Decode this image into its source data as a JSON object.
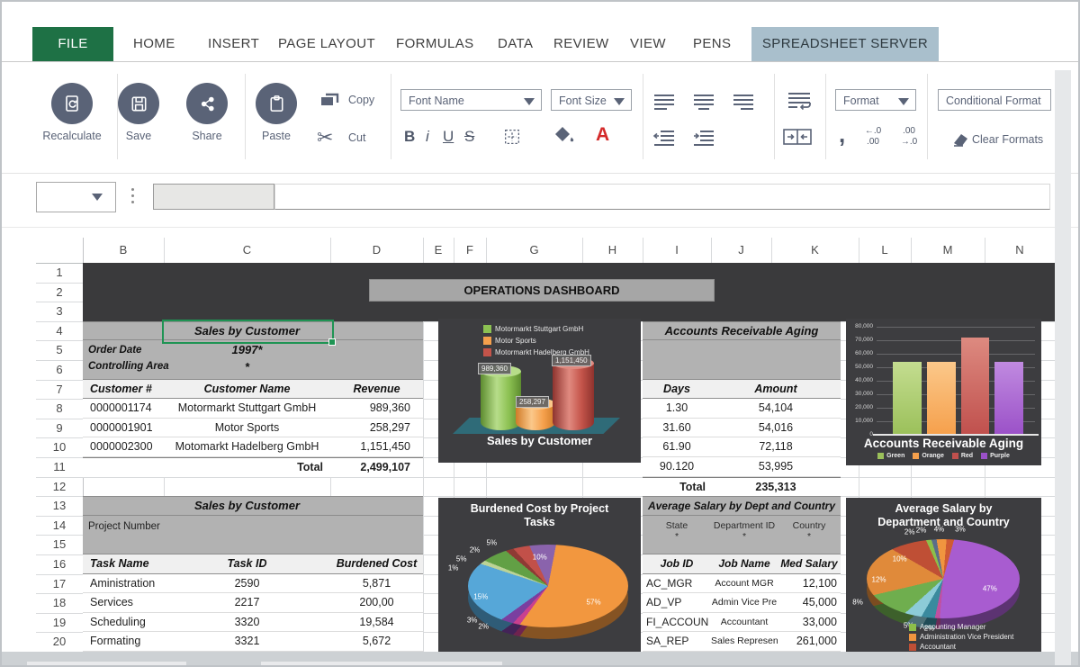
{
  "tabs": {
    "items": [
      "FILE",
      "HOME",
      "INSERT",
      "PAGE LAYOUT",
      "FORMULAS",
      "DATA",
      "REVIEW",
      "VIEW",
      "PENS",
      "SPREADSHEET SERVER"
    ],
    "active": "FILE",
    "accent_green": "#1e7145",
    "highlight_bg": "#a9bfcc"
  },
  "toolbar": {
    "recalculate_label": "Recalculate",
    "save_label": "Save",
    "share_label": "Share",
    "paste_label": "Paste",
    "copy_label": "Copy",
    "cut_label": "Cut",
    "font_name_placeholder": "Font Name",
    "font_size_placeholder": "Font Size",
    "bold": "B",
    "italic": "i",
    "underline": "U",
    "strike": "S",
    "font_color": "A",
    "format_label": "Format",
    "conditional_format_label": "Conditional Format",
    "clear_formats_label": "Clear Formats",
    "comma": ",",
    "dec_inc_top": "←.0",
    "dec_inc_bottom": ".00",
    "dec_dec_top": ".00",
    "dec_dec_bottom": "→.0",
    "icon_color": "#5a6377",
    "font_color_red": "#d42a2a"
  },
  "grid": {
    "columns": [
      "B",
      "C",
      "D",
      "E",
      "F",
      "G",
      "H",
      "I",
      "J",
      "K",
      "L",
      "M",
      "N"
    ],
    "rows": [
      "1",
      "2",
      "3",
      "4",
      "5",
      "6",
      "7",
      "8",
      "9",
      "10",
      "11",
      "12",
      "13",
      "14",
      "15",
      "16",
      "17",
      "18",
      "19",
      "20"
    ]
  },
  "dashboard": {
    "banner_title": "OPERATIONS DASHBOARD",
    "sales": {
      "title": "Sales by Customer",
      "filters": [
        {
          "label": "Order Date",
          "value": "1997*"
        },
        {
          "label": "Controlling Area",
          "value": "*"
        }
      ],
      "columns": [
        "Customer  #",
        "Customer Name",
        "Revenue"
      ],
      "rows": [
        [
          "0000001174",
          "Motormarkt Stuttgart GmbH",
          "989,360"
        ],
        [
          "0000001901",
          "Motor Sports",
          "258,297"
        ],
        [
          "0000002300",
          "Motomarkt Hadelberg GmbH",
          "1,151,450"
        ]
      ],
      "total_label": "Total",
      "total_value": "2,499,107"
    },
    "ar": {
      "title": "Accounts Receivable Aging",
      "columns": [
        "Days",
        "Amount"
      ],
      "rows": [
        [
          "1.30",
          "54,104"
        ],
        [
          "31.60",
          "54,016"
        ],
        [
          "61.90",
          "72,118"
        ],
        [
          "90.120",
          "53,995"
        ]
      ],
      "total_label": "Total",
      "total_value": "235,313"
    },
    "tasks": {
      "title": "Sales by Customer",
      "filter_label": "Project Number",
      "columns": [
        "Task Name",
        "Task ID",
        "Burdened Cost"
      ],
      "rows": [
        [
          "Aministration",
          "2590",
          "5,871"
        ],
        [
          "Services",
          "2217",
          "200,00"
        ],
        [
          "Scheduling",
          "3320",
          "19,584"
        ],
        [
          "Formating",
          "3321",
          "5,672"
        ]
      ]
    },
    "salary": {
      "title": "Average Salary by Dept and Country",
      "filters": [
        {
          "label": "State",
          "value": "*"
        },
        {
          "label": "Department ID",
          "value": "*"
        },
        {
          "label": "Country",
          "value": "*"
        }
      ],
      "columns": [
        "Job ID",
        "Job Name",
        "Med Salary"
      ],
      "rows": [
        [
          "AC_MGR",
          "Account MGR",
          "12,100"
        ],
        [
          "AD_VP",
          "Admin Vice Pre",
          "45,000"
        ],
        [
          "FI_ACCOUN",
          "Accountant",
          "33,000"
        ],
        [
          "SA_REP",
          "Sales Represen",
          "261,000"
        ]
      ]
    }
  },
  "chart_data": [
    {
      "type": "bar",
      "style": "3d-cylinder",
      "title": "Sales by Customer",
      "categories": [
        "Motormarkt Stuttgart GmbH",
        "Motor Sports",
        "Motormarkt Hadelberg GmbH"
      ],
      "values": [
        989360,
        258297,
        1151450
      ],
      "data_labels": [
        "989,360",
        "258,297",
        "1,151,450"
      ],
      "colors": [
        "#8cc152",
        "#f5a04c",
        "#c4544a"
      ],
      "colors_light": [
        "#b7dd8a",
        "#fbc88a",
        "#e08a80"
      ],
      "colors_dark": [
        "#5d8c2f",
        "#d07b28",
        "#8e332e"
      ],
      "legend_position": "top-left",
      "background": "#3d3d40",
      "floor_color": "#2f6b78"
    },
    {
      "type": "bar",
      "title": "Accounts Receivable Aging",
      "categories": [
        "Green",
        "Orange",
        "Red",
        "Purple"
      ],
      "values": [
        54104,
        54016,
        72118,
        53995
      ],
      "colors": [
        "#9bc05a",
        "#f5a04c",
        "#c0504d",
        "#9b51c8"
      ],
      "colors_light": [
        "#c4dd90",
        "#fbc88a",
        "#dd8a80",
        "#c08ae0"
      ],
      "ylim": [
        0,
        80000
      ],
      "yticks": [
        "80,000",
        "70,000",
        "60,000",
        "50,000",
        "40,000",
        "30,000",
        "20,000",
        "10,000",
        "0"
      ],
      "grid": true,
      "legend_position": "bottom",
      "background": "#3d3d40"
    },
    {
      "type": "pie",
      "title": "Burdened Cost by Project Tasks",
      "title_lines": [
        "Burdened Cost by Project",
        "Tasks"
      ],
      "start_angle": -25,
      "slices": [
        {
          "label": "10%",
          "value": 10,
          "color": "#8a63ac"
        },
        {
          "label": "57%",
          "value": 57,
          "color": "#f2973f"
        },
        {
          "label": "2%",
          "value": 2,
          "color": "#c9408f"
        },
        {
          "label": "3%",
          "value": 3,
          "color": "#7a3fa0"
        },
        {
          "label": "15%",
          "value": 15,
          "color": "#56a7d8"
        },
        {
          "label": "1%",
          "value": 1,
          "color": "#bcd396"
        },
        {
          "label": "5%",
          "value": 5,
          "color": "#62a045"
        },
        {
          "label": "2%",
          "value": 2,
          "color": "#8e3a34"
        },
        {
          "label": "5%",
          "value": 5,
          "color": "#c25049"
        }
      ],
      "background": "#3d3d40"
    },
    {
      "type": "pie",
      "title": "Average Salary by Department and Country",
      "title_lines": [
        "Average Salary by",
        "Department and Country"
      ],
      "start_angle": -24,
      "slices": [
        {
          "label": "2%",
          "value": 2,
          "color": "#8cbf4a"
        },
        {
          "label": "2%",
          "value": 2,
          "color": "#5b6d8a"
        },
        {
          "label": "4%",
          "value": 4,
          "color": "#f0953f"
        },
        {
          "label": "3%",
          "value": 3,
          "color": "#cf5b33"
        },
        {
          "label": "47%",
          "value": 47,
          "color": "#a85cd0"
        },
        {
          "label": "2%",
          "value": 2,
          "color": "#c050a0"
        },
        {
          "label": "5%",
          "value": 5,
          "color": "#3a8a9e"
        },
        {
          "label": "",
          "value": 5,
          "color": "#8cccd8"
        },
        {
          "label": "8%",
          "value": 8,
          "color": "#6fae4e"
        },
        {
          "label": "12%",
          "value": 12,
          "color": "#e08a3a"
        },
        {
          "label": "10%",
          "value": 10,
          "color": "#bf4f35"
        }
      ],
      "legend": [
        {
          "label": "Accounting Manager",
          "color": "#8cbf4a"
        },
        {
          "label": "Administration Vice President",
          "color": "#f0953f"
        },
        {
          "label": "Accountant",
          "color": "#bf4f35"
        }
      ],
      "background": "#3d3d40"
    }
  ]
}
